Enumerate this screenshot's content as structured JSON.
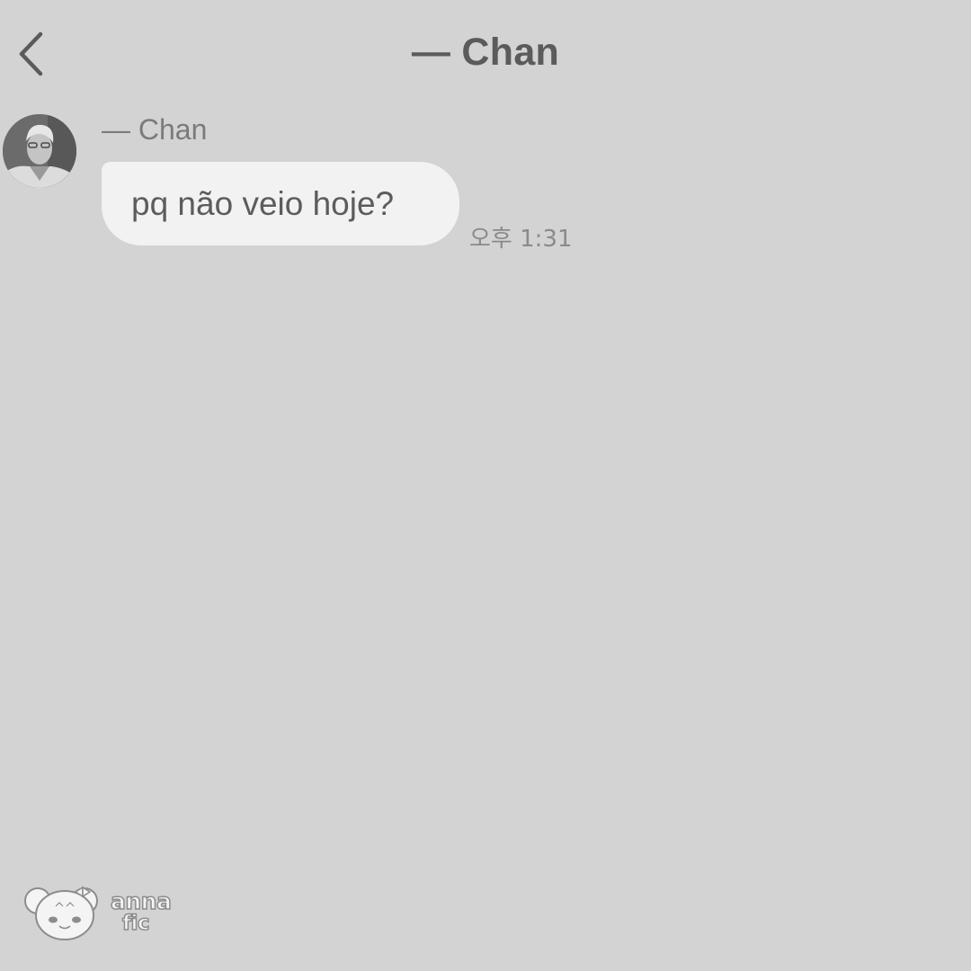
{
  "header": {
    "title": "— Chan"
  },
  "message": {
    "sender": "— Chan",
    "text": "pq não veio hoje?",
    "time": "오후 1:31"
  },
  "watermark": {
    "line1": "anna",
    "line2": "fic"
  },
  "colors": {
    "background": "#d3d3d3",
    "bubble": "#f2f2f2",
    "text": "#5c5c5c"
  }
}
